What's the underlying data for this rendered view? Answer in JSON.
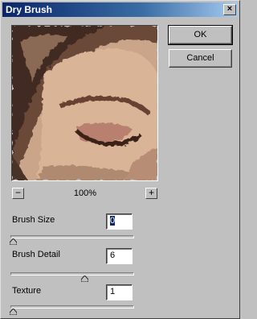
{
  "window": {
    "title": "Dry Brush",
    "close_symbol": "×"
  },
  "buttons": {
    "ok": "OK",
    "cancel": "Cancel"
  },
  "zoom": {
    "minus": "−",
    "plus": "+",
    "level": "100%"
  },
  "params": [
    {
      "label": "Brush Size",
      "value": "0",
      "slider_fraction": 0.0,
      "selected": true
    },
    {
      "label": "Brush Detail",
      "value": "6",
      "slider_fraction": 0.6,
      "selected": false
    },
    {
      "label": "Texture",
      "value": "1",
      "slider_fraction": 0.0,
      "selected": false
    }
  ]
}
